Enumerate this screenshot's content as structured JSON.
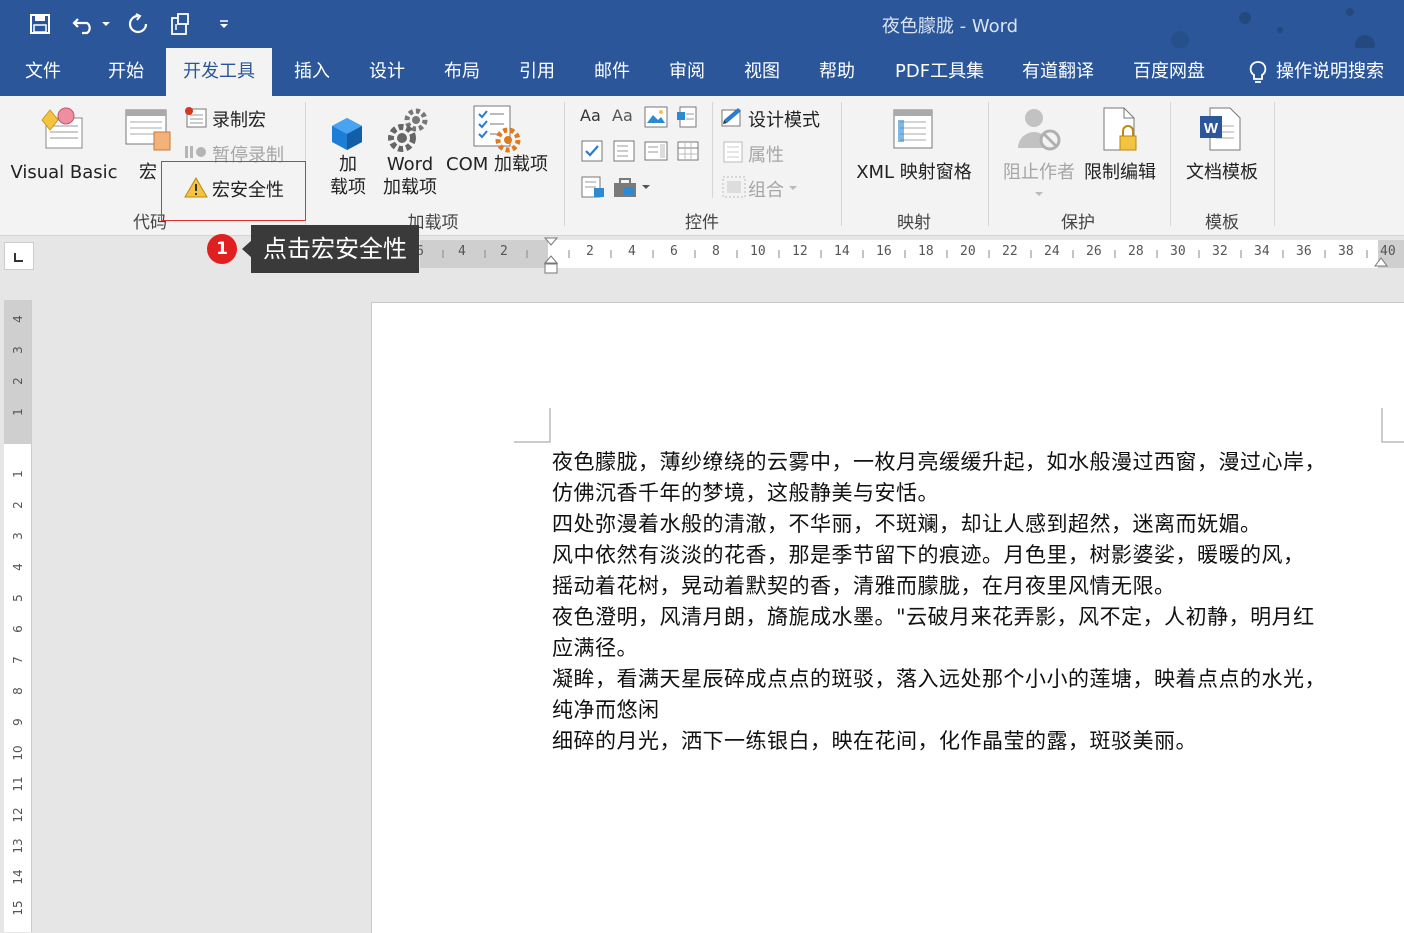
{
  "titlebar": {
    "title": "夜色朦胧  -  Word",
    "qat_icons": [
      "save-icon",
      "undo-icon",
      "dropdown-icon",
      "redo-icon",
      "touch-mode-icon",
      "customize-qat-icon"
    ]
  },
  "tabs": [
    {
      "label": "文件",
      "active": false
    },
    {
      "label": "开始",
      "active": false
    },
    {
      "label": "开发工具",
      "active": true
    },
    {
      "label": "插入",
      "active": false
    },
    {
      "label": "设计",
      "active": false
    },
    {
      "label": "布局",
      "active": false
    },
    {
      "label": "引用",
      "active": false
    },
    {
      "label": "邮件",
      "active": false
    },
    {
      "label": "审阅",
      "active": false
    },
    {
      "label": "视图",
      "active": false
    },
    {
      "label": "帮助",
      "active": false
    },
    {
      "label": "PDF工具集",
      "active": false
    },
    {
      "label": "有道翻译",
      "active": false
    },
    {
      "label": "百度网盘",
      "active": false
    }
  ],
  "tell_me": "操作说明搜索",
  "ribbon": {
    "code": {
      "label": "代码",
      "visual_basic": "Visual Basic",
      "macros": "宏",
      "record_macro": "录制宏",
      "pause_recording": "暂停录制",
      "macro_security": "宏安全性"
    },
    "addins": {
      "label": "加载项",
      "addins_line1": "加",
      "addins_line2": "载项",
      "word_addins_line1": "Word",
      "word_addins_line2": "加载项",
      "com_addins": "COM 加载项"
    },
    "controls": {
      "label": "控件",
      "design_mode": "设计模式",
      "properties": "属性",
      "group": "组合"
    },
    "mapping": {
      "label": "映射",
      "xml_pane": "XML 映射窗格"
    },
    "protect": {
      "label": "保护",
      "block_authors": "阻止作者",
      "restrict_editing": "限制编辑"
    },
    "templates": {
      "label": "模板",
      "document_template": "文档模板"
    }
  },
  "ruler": {
    "left_nums": [
      "6",
      "4",
      "2"
    ],
    "right_nums": [
      "2",
      "4",
      "6",
      "8",
      "10",
      "12",
      "14",
      "16",
      "18",
      "20",
      "22",
      "24",
      "26",
      "28",
      "30",
      "32",
      "34",
      "36",
      "38",
      "40"
    ],
    "vertical_top": [
      "4",
      "3",
      "2",
      "1"
    ],
    "vertical_body": [
      "1",
      "2",
      "3",
      "4",
      "5",
      "6",
      "7",
      "8",
      "9",
      "10",
      "11",
      "12",
      "13",
      "14",
      "15"
    ]
  },
  "callout": {
    "number": "1",
    "text": "点击宏安全性"
  },
  "document": {
    "lines": [
      "夜色朦胧，薄纱缭绕的云雾中，一枚月亮缓缓升起，如水般漫过西窗，漫过心岸，",
      "仿佛沉香千年的梦境，这般静美与安恬。",
      "四处弥漫着水般的清澈，不华丽，不斑斓，却让人感到超然，迷离而妩媚。",
      "风中依然有淡淡的花香，那是季节留下的痕迹。月色里，树影婆娑，暖暖的风，",
      "摇动着花树，晃动着默契的香，清雅而朦胧，在月夜里风情无限。",
      "夜色澄明，风清月朗，旖旎成水墨。\"云破月来花弄影，风不定，人初静，明月红",
      "应满径。",
      "凝眸，看满天星辰碎成点点的斑驳，落入远处那个小小的莲塘，映着点点的水光，",
      "纯净而悠闲",
      "细碎的月光，洒下一练银白，映在花间，化作晶莹的露，斑驳美丽。"
    ]
  }
}
